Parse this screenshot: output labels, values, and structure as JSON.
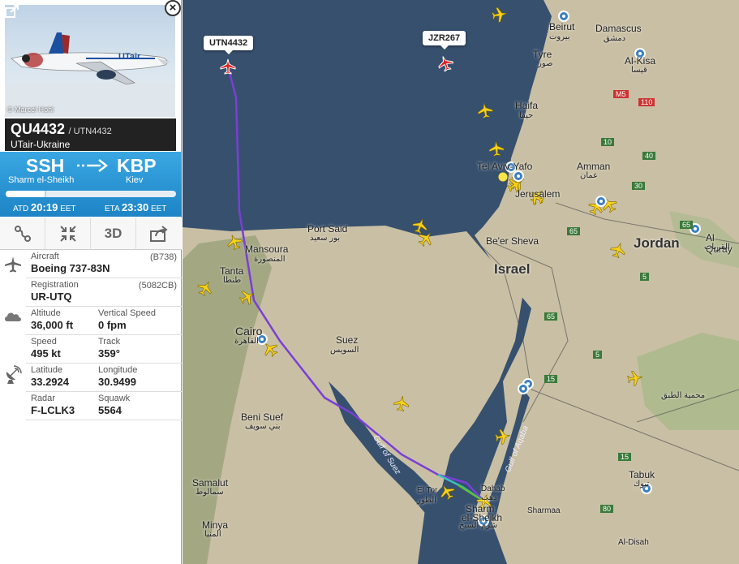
{
  "flight": {
    "photo_credit": "© Marcel Hohl",
    "flight_number": "QU4432",
    "callsign": "/ UTN4432",
    "airline": "UTair-Ukraine",
    "livery_text": "UTair",
    "origin_code": "SSH",
    "origin_city": "Sharm el-Sheikh",
    "dest_code": "KBP",
    "dest_city": "Kiev",
    "progress": 0.24,
    "atd_label": "ATD",
    "atd_time": "20:19",
    "atd_tz": "EET",
    "eta_label": "ETA",
    "eta_time": "23:30",
    "eta_tz": "EET",
    "close_symbol": "×"
  },
  "tools": {
    "route_icon": "route-icon",
    "collapse_icon": "collapse-icon",
    "label_3d": "3D",
    "share_icon": "share-icon"
  },
  "details": {
    "aircraft_label": "Aircraft",
    "aircraft_value": "Boeing 737-83N",
    "aircraft_code": "(B738)",
    "registration_label": "Registration",
    "registration_value": "UR-UTQ",
    "registration_code": "(5082CB)",
    "altitude_label": "Altitude",
    "altitude_value": "36,000 ft",
    "vspeed_label": "Vertical Speed",
    "vspeed_value": "0 fpm",
    "speed_label": "Speed",
    "speed_value": "495 kt",
    "track_label": "Track",
    "track_value": "359°",
    "lat_label": "Latitude",
    "lat_value": "33.2924",
    "lon_label": "Longitude",
    "lon_value": "30.9499",
    "radar_label": "Radar",
    "radar_value": "F-LCLK3",
    "squawk_label": "Squawk",
    "squawk_value": "5564"
  },
  "map": {
    "tags": {
      "utn": "UTN4432",
      "jzr": "JZR267"
    },
    "labels": {
      "beirut": "Beirut",
      "beirut_ar": "بيروت",
      "damascus": "Damascus",
      "damascus_ar": "دمشق",
      "alkisa": "Al-Kisa",
      "alkisa_ar": "قيسا",
      "tyre": "Tyre",
      "tyre_ar": "صور",
      "haifa": "Haifa",
      "haifa_ar": "حيفا",
      "telaviv": "Tel Aviv-Yafo",
      "amman": "Amman",
      "amman_ar": "عمان",
      "jerusalem": "Jerusalem",
      "portsaid": "Port Said",
      "portsaid_ar": "بور سعيد",
      "beersheva": "Be'er Sheva",
      "israel": "Israel",
      "jordan": "Jordan",
      "mansoura": "Mansoura",
      "mansoura_ar": "المنصورة",
      "tanta": "Tanta",
      "tanta_ar": "طنطا",
      "cairo": "Cairo",
      "cairo_ar": "القاهرة",
      "suez": "Suez",
      "suez_ar": "السويس",
      "alquray": "Al Quray",
      "alquray_ar": "القريات",
      "reserve_ar": "محمية الطبق",
      "benisuef": "Beni Suef",
      "benisuef_ar": "بني سويف",
      "gulfsuez": "Gulf of Suez",
      "gulfaqaba": "Gulf of Aqaba",
      "eltor": "El Tor",
      "eltor_ar": "الطور",
      "dahab": "Dahab",
      "dahab_ar": "دهب",
      "sharm": "Sharm",
      "sharm2": "el-Sheikh",
      "sharm_ar": "شرم الشيخ",
      "sharmaa": "Sharmaa",
      "tabuk": "Tabuk",
      "tabuk_ar": "تبوك",
      "samalut": "Samalut",
      "samalut_ar": "سمالوط",
      "minya": "Minya",
      "minya_ar": "المنيا",
      "aldisah": "Al-Disah"
    },
    "shields": {
      "m5": "M5",
      "s110": "110",
      "s10": "10",
      "s30": "30",
      "s40": "40",
      "s65a": "65",
      "s65b": "65",
      "s15a": "15",
      "s15b": "15",
      "s5a": "5",
      "s5b": "5",
      "s80": "80",
      "s65c": "65"
    },
    "colors": {
      "water": "#36506e",
      "land": "#c9bfa4",
      "track": "#7a3fd6"
    }
  }
}
